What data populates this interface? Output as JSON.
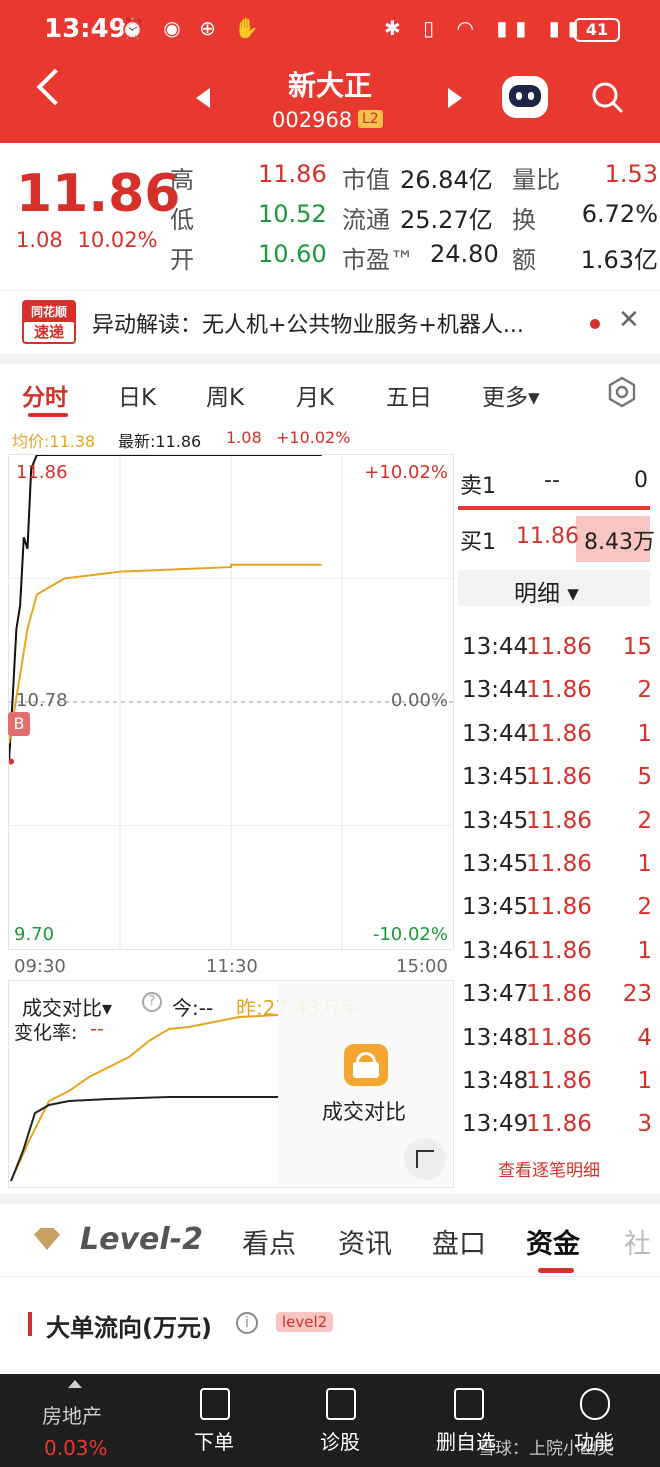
{
  "status": {
    "time": "13:49",
    "battery": "41"
  },
  "header": {
    "title": "新大正",
    "code": "002968",
    "level_tag": "L2"
  },
  "quote": {
    "price": "11.86",
    "change_abs": "1.08",
    "change_pct": "10.02%",
    "high_label": "高",
    "high": "11.86",
    "low_label": "低",
    "low": "10.52",
    "open_label": "开",
    "open": "10.60",
    "mcap_label": "市值",
    "mcap": "26.84亿",
    "float_label": "流通",
    "float": "25.27亿",
    "pe_label": "市盈™",
    "pe": "24.80",
    "vr_label": "量比",
    "vr": "1.53",
    "turnover_label": "换",
    "turnover": "6.72%",
    "amount_label": "额",
    "amount": "1.63亿"
  },
  "ticker": {
    "logo_top": "同花顺",
    "logo_bottom": "速递",
    "text": "异动解读：无人机+公共物业服务+机器人..."
  },
  "tabs": [
    "分时",
    "日K",
    "周K",
    "月K",
    "五日",
    "更多▾"
  ],
  "infoline": {
    "avg": "均价:11.38",
    "latest": "最新:11.86",
    "chg": "1.08",
    "pct": "+10.02%"
  },
  "chart": {
    "y_top": "11.86",
    "y_mid": "10.78",
    "y_bottom": "9.70",
    "pct_top": "+10.02%",
    "pct_mid": "0.00%",
    "pct_bottom": "-10.02%",
    "x_start": "09:30",
    "x_mid": "11:30",
    "x_end": "15:00",
    "buy_marker": "B"
  },
  "chart_data": {
    "type": "line",
    "x_range": [
      "09:30",
      "15:00"
    ],
    "ylim": [
      9.7,
      11.86
    ],
    "series": [
      {
        "name": "",
        "x": [
          "09:30",
          "09:32",
          "09:34",
          "09:36",
          "09:38",
          "09:40",
          "09:42",
          "09:45",
          "10:00",
          "10:30",
          "11:30",
          "13:49"
        ],
        "values": [
          10.52,
          10.8,
          11.1,
          11.2,
          11.5,
          11.45,
          11.8,
          11.86,
          11.86,
          11.86,
          11.86,
          11.86
        ]
      },
      {
        "name": "均价",
        "x": [
          "09:30",
          "09:35",
          "09:40",
          "09:45",
          "10:00",
          "10:30",
          "11:30",
          "13:00",
          "13:49"
        ],
        "values": [
          10.6,
          10.85,
          11.1,
          11.25,
          11.32,
          11.35,
          11.37,
          11.38,
          11.38
        ]
      }
    ]
  },
  "orderbook": {
    "sell_label": "卖1",
    "sell_price": "--",
    "sell_vol": "0",
    "buy_label": "买1",
    "buy_price": "11.86",
    "buy_vol": "8.43万",
    "detail_label": "明细 ▾",
    "trades": [
      {
        "t": "13:44",
        "p": "11.86",
        "v": "15"
      },
      {
        "t": "13:44",
        "p": "11.86",
        "v": "2"
      },
      {
        "t": "13:44",
        "p": "11.86",
        "v": "1"
      },
      {
        "t": "13:45",
        "p": "11.86",
        "v": "5"
      },
      {
        "t": "13:45",
        "p": "11.86",
        "v": "2"
      },
      {
        "t": "13:45",
        "p": "11.86",
        "v": "1"
      },
      {
        "t": "13:45",
        "p": "11.86",
        "v": "2"
      },
      {
        "t": "13:46",
        "p": "11.86",
        "v": "1"
      },
      {
        "t": "13:47",
        "p": "11.86",
        "v": "23"
      },
      {
        "t": "13:48",
        "p": "11.86",
        "v": "4"
      },
      {
        "t": "13:48",
        "p": "11.86",
        "v": "1"
      },
      {
        "t": "13:49",
        "p": "11.86",
        "v": "3"
      }
    ],
    "view_all": "查看逐笔明细"
  },
  "volume": {
    "title": "成交对比▾",
    "today": "今:--",
    "yesterday": "昨:27.43万手",
    "rate_label": "变化率:",
    "rate_value": "--",
    "lock_label": "成交对比"
  },
  "bottom_tabs": [
    "Level-2",
    "看点",
    "资讯",
    "盘口",
    "资金",
    "社"
  ],
  "section": {
    "title": "大单流向(万元)",
    "tag": "level2"
  },
  "bottom_bar": {
    "sector": "房地产",
    "sector_pct": "0.03%",
    "items": [
      "下单",
      "诊股",
      "删自选",
      "功能"
    ],
    "watermark": "雪球：上院小幽灵"
  },
  "colors": {
    "up": "#d6302a",
    "down": "#1a9a3a",
    "avg_line": "#e6a520",
    "bar": "#e8382f"
  }
}
